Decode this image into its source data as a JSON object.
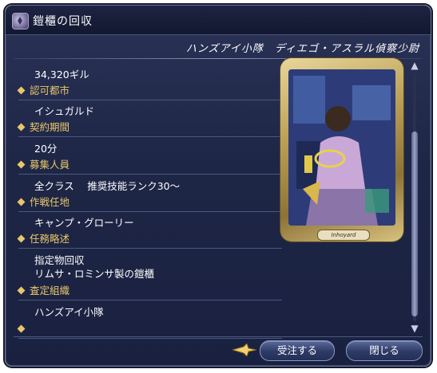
{
  "window": {
    "title": "鎧櫃の回収",
    "subtitle": "ハンズアイ小隊　ディエゴ・アスラル偵察少尉"
  },
  "fields": [
    {
      "value": "34,320ギル",
      "label": "認可都市"
    },
    {
      "value": "イシュガルド",
      "label": "契約期間"
    },
    {
      "value": "20分",
      "label": "募集人員"
    },
    {
      "value": "全クラス　 推奨技能ランク30～",
      "label": "作戦任地"
    },
    {
      "value": "キャンプ・グローリー",
      "label": "任務略述"
    },
    {
      "value": "指定物回収\nリムサ・ロミンサ製の鎧櫃",
      "label": "査定組織"
    },
    {
      "value": "ハンズアイ小隊",
      "label": ""
    }
  ],
  "card": {
    "caption": "Inhoyard"
  },
  "buttons": {
    "accept": "受注する",
    "close": "閉じる"
  },
  "colors": {
    "label_gold": "#e8c76a",
    "panel_bg": "#1e2646",
    "text": "#ffffff"
  }
}
